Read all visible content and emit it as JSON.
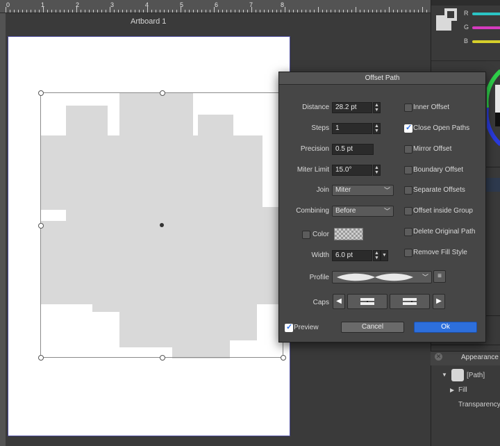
{
  "ruler": {
    "labels": [
      "0",
      "1",
      "2",
      "3",
      "4",
      "5",
      "6",
      "7",
      "8"
    ]
  },
  "artboard": {
    "title": "Artboard 1",
    "shape_color": "#d9d9d9"
  },
  "color_panel": {
    "channels": [
      {
        "label": "R",
        "color": "#2bc4c4"
      },
      {
        "label": "G",
        "color": "#d63bbf"
      },
      {
        "label": "B",
        "color": "#d6cf2b"
      }
    ]
  },
  "appearance_panel": {
    "tab_label": "Appearance",
    "item_label": "[Path]",
    "fill_label": "Fill",
    "transparency_label": "Transparency"
  },
  "dialog": {
    "title": "Offset Path",
    "distance_label": "Distance",
    "distance_value": "28.2 pt",
    "steps_label": "Steps",
    "steps_value": "1",
    "precision_label": "Precision",
    "precision_value": "0.5 pt",
    "miter_label": "Miter Limit",
    "miter_value": "15.0°",
    "join_label": "Join",
    "join_value": "Miter",
    "combining_label": "Combining",
    "combining_value": "Before",
    "color_label": "Color",
    "width_label": "Width",
    "width_value": "6.0 pt",
    "profile_label": "Profile",
    "caps_label": "Caps",
    "options": [
      {
        "label": "Inner Offset",
        "checked": false
      },
      {
        "label": "Close Open Paths",
        "checked": true
      },
      {
        "label": "Mirror Offset",
        "checked": false
      },
      {
        "label": "Boundary Offset",
        "checked": false
      },
      {
        "label": "Separate Offsets",
        "checked": false
      },
      {
        "label": "Offset inside Group",
        "checked": false
      },
      {
        "label": "Delete Original Path",
        "checked": false
      },
      {
        "label": "Remove Fill Style",
        "checked": false
      }
    ],
    "preview_label": "Preview",
    "cancel_label": "Cancel",
    "ok_label": "Ok",
    "accent_color": "#2d6fdc"
  }
}
